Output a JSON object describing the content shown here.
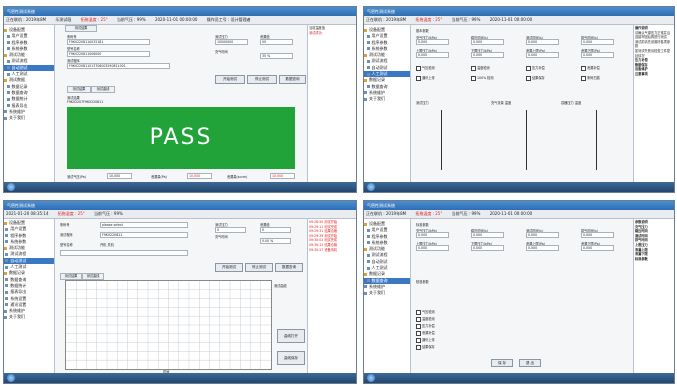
{
  "shot1": {
    "title": "气密性测试系统",
    "status": [
      "正在联机 : 2019年8M",
      "乐测试段",
      "拓拖温度 : 25°",
      "当前气压 : 99%",
      "2020-11-01 00:00:00",
      "操作员工号 : 设计管理者"
    ],
    "tree": [
      "设备配置",
      "用户设置",
      "程序参数",
      "系统参数",
      "测试功能",
      "测试流程",
      "自动测试",
      "人工测试",
      "测试数据",
      "数据记录",
      "数据查询",
      "数据统计",
      "报表导出",
      "系统维护",
      "关于我们"
    ],
    "tab_main": "测试结果",
    "fields": {
      "barcode_label": "条码号",
      "barcode": "F9K02208110032181",
      "model_label": "型号名称",
      "model": "F9K0220811006000",
      "program_label": "测试程序",
      "program": "F9K0220811013706003290811001",
      "f1": "测试压力",
      "v1": "10000000",
      "f2": "泄漏值",
      "v2": "00",
      "f3": "充气时间",
      "v3": "35 %"
    },
    "buttons": [
      "开始测试",
      "停止测试",
      "数据查询"
    ],
    "subtabs": [
      "测试结果",
      "测试曲线"
    ],
    "result_label": "测试结果",
    "result_code": "F9K02207F9K0220811",
    "result": "PASS",
    "bottom": [
      {
        "label": "测试气压(Pa)",
        "value": "10,000"
      },
      {
        "label": "泄漏量(Pa)",
        "value": "10,000"
      },
      {
        "label": "泄漏量(sccm)",
        "value": "10,000"
      }
    ],
    "log": [
      "当前温度值",
      "测试成功"
    ]
  },
  "shot2": {
    "title": "气密性测试系统",
    "status": [
      "正在联机 : 2019年8M",
      "拓拖温度 : 25°",
      "当前气压 : 99%",
      "2020-11-01 00:00:00"
    ],
    "tree": [
      "设备配置",
      "用户设置",
      "程序参数",
      "系统参数",
      "测试功能",
      "测试流程",
      "自动测试",
      "人工测试",
      "数据记录",
      "数据查询",
      "系统维护",
      "关于我们"
    ],
    "section1": "基本参数",
    "fields": [
      "充气压力(kPa)",
      "稳压时间(s)",
      "测试时间(s)",
      "排气时间(s)",
      "上限压力(kPa)",
      "下限压力(kPa)",
      "泄漏上限(Pa)",
      "泄漏下限(Pa)"
    ],
    "values": [
      "0.000",
      "0.000",
      "0.000",
      "0.000",
      "0.000",
      "0.000",
      "0.000",
      "0.000"
    ],
    "checks": [
      "气压检测",
      "温度检测",
      "压力补偿",
      "泄漏补偿",
      "通讯上传",
      "100% 检测",
      "结果保存",
      "条码扫描"
    ],
    "panels": [
      "测试压力",
      "充气流量 温度",
      "容器压力 温度"
    ],
    "help_title": "操作说明",
    "help": [
      "请确认气源压力正常并且连接牢固后再进行测试",
      "测试前请先设置好各项参数",
      "如测试失败请检查工件密封情况",
      "压力补偿",
      "数据保存",
      "设备维护",
      "注意事项"
    ]
  },
  "shot3": {
    "title": "气密性测试系统",
    "status": [
      "2021-01-20 08:35:14",
      "拓拖温度 : 25°",
      "当前气压 : 99%"
    ],
    "tree": [
      "设备配置",
      "用户设置",
      "程序参数",
      "系统参数",
      "测试功能",
      "测试流程",
      "自动测试",
      "人工测试",
      "数据记录",
      "数据查询",
      "数据统计",
      "报表导出",
      "系统设置",
      "通讯设置",
      "系统维护",
      "关于我们"
    ],
    "barcode_label": "条码号",
    "placeholder": "please select",
    "program_label": "测试程序",
    "program": "F9K0220811",
    "model_label": "型号名称",
    "check": "开机  关机",
    "f1": "测试压力",
    "f2": "泄漏值",
    "f3": "充气时间",
    "v1": "0",
    "v2": "0",
    "v3": "0.00 %",
    "buttons": [
      "开始测试",
      "停止测试",
      "数据查询"
    ],
    "tabs": [
      "测试结果",
      "测试曲线"
    ],
    "side_buttons": [
      "曲线打开",
      "曲线保存"
    ],
    "legend": "测试曲线",
    "y_ticks": [
      "10",
      "9",
      "8",
      "7",
      "6",
      "5",
      "4",
      "3",
      "2",
      "1",
      "0"
    ],
    "x_label": "时间",
    "log": [
      "09:28:50 测试开始",
      "09:29:11 测试完成",
      "09:29:31 结果合格",
      "09:29:39 测试开始",
      "09:30:01 测试完成",
      "09:30:12 结果合格",
      "09:30:27 设备待机"
    ]
  },
  "shot4": {
    "title": "气密性测试系统",
    "status": [
      "正在联机 : 2019年8M",
      "拓拖温度 : 25°",
      "当前气压 : 99%",
      "2020-11-01 00:00:00"
    ],
    "tree": [
      "设备配置",
      "用户设置",
      "程序参数",
      "系统参数",
      "测试功能",
      "测试流程",
      "自动测试",
      "人工测试",
      "数据记录",
      "数据查询",
      "系统维护",
      "关于我们"
    ],
    "section1": "标准参数",
    "section2": "校准参数",
    "fields": [
      "充气压力(kPa)",
      "稳压时间(s)",
      "测试时间(s)",
      "排气时间(s)",
      "上限压力(kPa)",
      "下限压力(kPa)",
      "泄漏上限(Pa)",
      "泄漏下限(Pa)"
    ],
    "values": [
      "0.000",
      "0.000",
      "0.000",
      "0.000",
      "0.000",
      "0.000",
      "0.000",
      "0.000"
    ],
    "rows": [
      "气压检测",
      "温度检测",
      "压力补偿",
      "泄漏补偿",
      "通讯上传",
      "结果保存"
    ],
    "buttons": [
      "保 存",
      "退 出"
    ],
    "help_title": "参数说明",
    "help": [
      "充气压力",
      "稳压时间",
      "测试时间",
      "排气时间",
      "上限压力",
      "泄漏上限",
      "泄漏下限",
      "标准参数"
    ]
  }
}
